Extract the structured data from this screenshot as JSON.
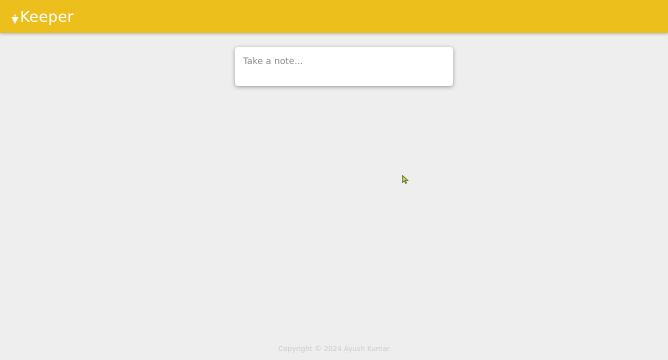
{
  "header": {
    "logo_text": "Keeper",
    "logo_icon": "lamp-icon",
    "background_color": "#ecbf1c"
  },
  "note": {
    "placeholder": "Take a note..."
  },
  "footer": {
    "copyright": "Copyright © 2024 Ayush Kumar"
  }
}
